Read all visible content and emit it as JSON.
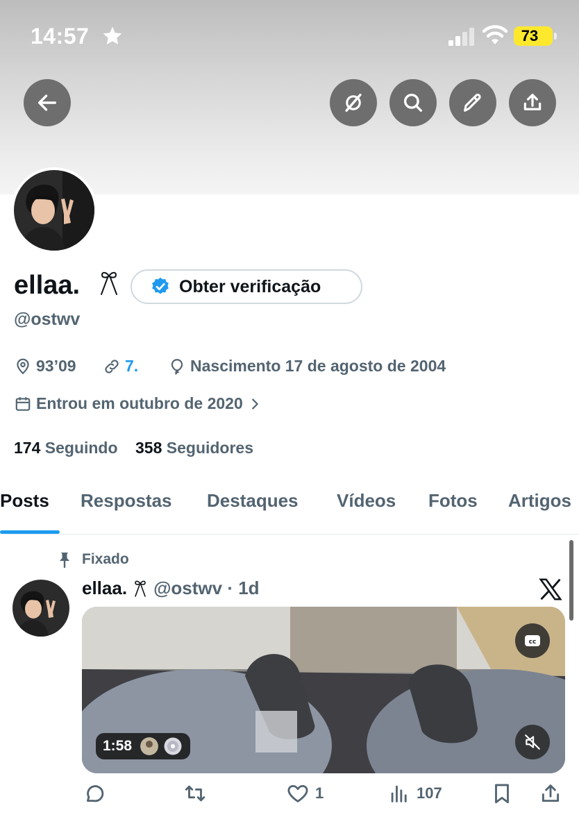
{
  "status_bar": {
    "time": "14:57",
    "battery": "73"
  },
  "profile": {
    "name": "ellaa.",
    "verify_label": "Obter verificação",
    "handle": "@ostwv",
    "location": "93’09",
    "link": "7.",
    "birth": "Nascimento 17 de agosto de 2004",
    "joined": "Entrou em outubro de 2020",
    "following_count": "174",
    "following_label": "Seguindo",
    "followers_count": "358",
    "followers_label": "Seguidores"
  },
  "tabs": [
    "Posts",
    "Respostas",
    "Destaques",
    "Vídeos",
    "Fotos",
    "Artigos"
  ],
  "post": {
    "pinned_label": "Fixado",
    "author": "ellaa.",
    "meta": "@ostwv · 1d",
    "duration": "1:58",
    "likes": "1",
    "views": "107"
  },
  "colors": {
    "accent": "#1d9bf0",
    "secondary_text": "#536471",
    "battery": "#fde82d"
  }
}
